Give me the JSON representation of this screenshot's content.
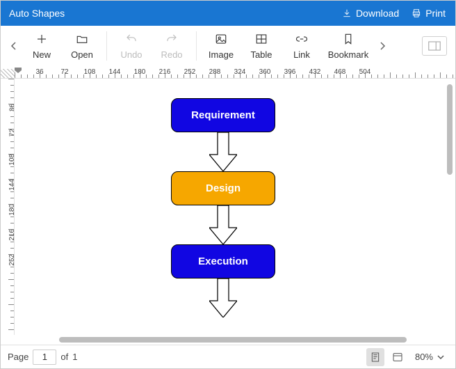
{
  "titlebar": {
    "title": "Auto Shapes",
    "download_label": "Download",
    "print_label": "Print"
  },
  "toolbar": {
    "new_label": "New",
    "open_label": "Open",
    "undo_label": "Undo",
    "redo_label": "Redo",
    "image_label": "Image",
    "table_label": "Table",
    "link_label": "Link",
    "bookmark_label": "Bookmark"
  },
  "ruler": {
    "h_labels": [
      "36",
      "72",
      "108",
      "144",
      "180",
      "216",
      "252",
      "288",
      "324",
      "360",
      "396",
      "432",
      "468",
      "504"
    ],
    "v_labels": [
      "36",
      "72",
      "108",
      "144",
      "180",
      "216",
      "252"
    ]
  },
  "page": {
    "shapes": [
      {
        "label": "Requirement",
        "color": "blue"
      },
      {
        "label": "Design",
        "color": "orange"
      },
      {
        "label": "Execution",
        "color": "blue"
      }
    ]
  },
  "status": {
    "page_prefix": "Page",
    "current_page": "1",
    "page_of": "of",
    "total_pages": "1",
    "zoom": "80%"
  }
}
